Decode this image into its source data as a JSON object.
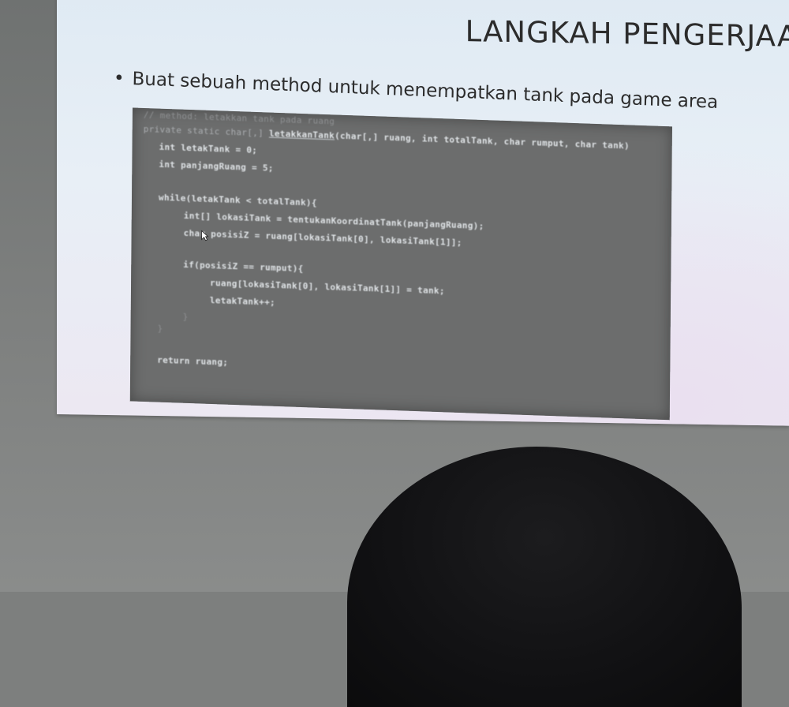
{
  "slide": {
    "title": "LANGKAH PENGERJAAN",
    "bullet": "Buat sebuah method untuk menempatkan tank pada game area"
  },
  "code": {
    "line0": "// method: letakkan tank pada ruang",
    "line1_kw": "private static char[,]",
    "line1_name": "letakkanTank",
    "line1_params": "(char[,] ruang, int totalTank, char rumput, char tank)",
    "line2": "int letakTank = 0;",
    "line3": "int panjangRuang = 5;",
    "line4": "while(letakTank < totalTank){",
    "line5": "int[] lokasiTank = tentukanKoordinatTank(panjangRuang);",
    "line6": "char posisiZ = ruang[lokasiTank[0], lokasiTank[1]];",
    "line7": "if(posisiZ == rumput){",
    "line8": "ruang[lokasiTank[0], lokasiTank[1]] = tank;",
    "line9": "letakTank++;",
    "line10": "}",
    "line11": "}",
    "line12": "return ruang;"
  }
}
